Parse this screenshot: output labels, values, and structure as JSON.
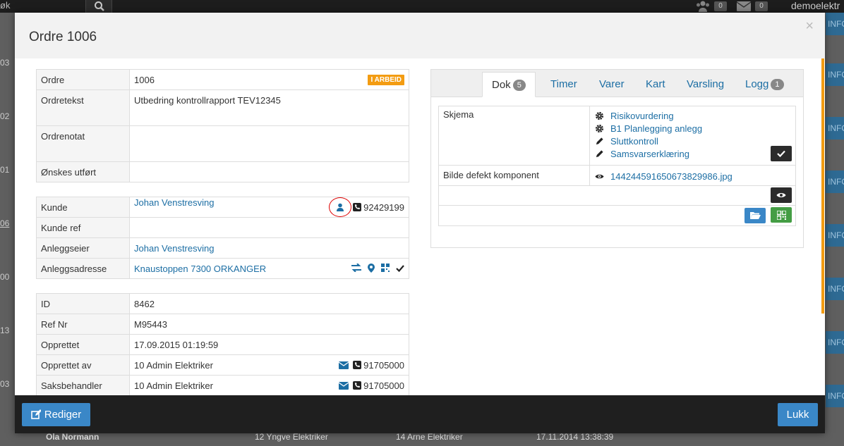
{
  "topbar": {
    "search_tail": "øk",
    "people_count": "0",
    "mail_count": "0",
    "user": "demoelektr"
  },
  "background": {
    "row_numbers": [
      "03",
      "02",
      "01",
      "06",
      "00",
      "13",
      "03"
    ],
    "info_label": "INFO",
    "bottom_row": [
      "Ola Normann",
      "12 Yngve Elektriker",
      "14 Arne Elektriker",
      "17.11.2014 13:38:39"
    ]
  },
  "modal": {
    "title": "Ordre 1006",
    "close": "×"
  },
  "order": {
    "rows": [
      {
        "label": "Ordre",
        "value": "1006",
        "status": "I ARBEID"
      },
      {
        "label": "Ordretekst",
        "value": "Utbedring kontrollrapport TEV12345"
      },
      {
        "label": "Ordrenotat",
        "value": ""
      },
      {
        "label": "Ønskes utført",
        "value": ""
      }
    ]
  },
  "customer": {
    "rows": [
      {
        "label": "Kunde",
        "value": "Johan Venstresving",
        "phone": "92429199"
      },
      {
        "label": "Kunde ref",
        "value": ""
      },
      {
        "label": "Anleggseier",
        "value": "Johan Venstresving"
      },
      {
        "label": "Anleggsadresse",
        "value": "Knaustoppen 7300 ORKANGER"
      }
    ]
  },
  "meta": {
    "rows": [
      {
        "label": "ID",
        "value": "8462"
      },
      {
        "label": "Ref Nr",
        "value": "M95443"
      },
      {
        "label": "Opprettet",
        "value": "17.09.2015 01:19:59"
      },
      {
        "label": "Opprettet av",
        "value": "10 Admin Elektriker",
        "phone": "91705000"
      },
      {
        "label": "Saksbehandler",
        "value": "10 Admin Elektriker",
        "phone": "91705000"
      }
    ]
  },
  "tabs": [
    {
      "label": "Dok",
      "count": "5"
    },
    {
      "label": "Timer"
    },
    {
      "label": "Varer"
    },
    {
      "label": "Kart"
    },
    {
      "label": "Varsling"
    },
    {
      "label": "Logg",
      "count": "1"
    }
  ],
  "docs": {
    "schema_label": "Skjema",
    "schema_items": [
      {
        "label": "Risikovurdering",
        "icon": "gear-icon"
      },
      {
        "label": "B1 Planlegging anlegg",
        "icon": "gear-icon"
      },
      {
        "label": "Sluttkontroll",
        "icon": "pencil-icon"
      },
      {
        "label": "Samsvarserklæring",
        "icon": "pencil-icon"
      }
    ],
    "image_label": "Bilde defekt komponent",
    "image_file": "1442445916506738299‌86.jpg"
  },
  "footer": {
    "edit_label": "Rediger",
    "close_label": "Lukk"
  },
  "colors": {
    "accent": "#1c6ea4",
    "status": "#f39c12",
    "primary_button": "#3a87c7",
    "success_button": "#449d44"
  }
}
